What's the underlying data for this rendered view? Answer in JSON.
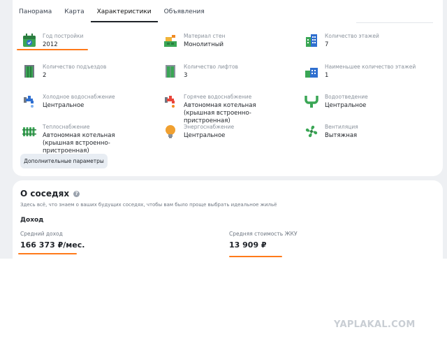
{
  "tabs": [
    {
      "label": "Панорама"
    },
    {
      "label": "Карта"
    },
    {
      "label": "Характеристики"
    },
    {
      "label": "Объявления"
    }
  ],
  "characteristics": [
    {
      "label": "Год постройки",
      "value": "2012",
      "icon": "calendar-icon"
    },
    {
      "label": "Материал стен",
      "value": "Монолитный",
      "icon": "bricks-icon"
    },
    {
      "label": "Количество этажей",
      "value": "7",
      "icon": "building-icon"
    },
    {
      "label": "Количество подъездов",
      "value": "2",
      "icon": "entrance-icon"
    },
    {
      "label": "Количество лифтов",
      "value": "3",
      "icon": "elevator-icon"
    },
    {
      "label": "Наименьшее количество этажей",
      "value": "1",
      "icon": "low-building-icon"
    },
    {
      "label": "Холодное водоснабжение",
      "value": "Центральное",
      "icon": "cold-tap-icon"
    },
    {
      "label": "Горячее водоснабжение",
      "value": "Автономная котельная (крышная встроенно-пристроенная)",
      "icon": "hot-tap-icon"
    },
    {
      "label": "Водоотведение",
      "value": "Центральное",
      "icon": "drain-pipe-icon"
    },
    {
      "label": "Теплоснабжение",
      "value": "Автономная котельная (крышная встроенно-пристроенная)",
      "icon": "radiator-icon"
    },
    {
      "label": "Энергоснабжение",
      "value": "Центральное",
      "icon": "lightbulb-icon"
    },
    {
      "label": "Вентиляция",
      "value": "Вытяжная",
      "icon": "fan-icon"
    }
  ],
  "more_button": "Дополнительные параметры",
  "neighbors": {
    "title": "О соседях",
    "help": "?",
    "subtitle": "Здесь всё, что знаем о ваших будущих соседях, чтобы вам было проще выбрать идеальное жильё",
    "section": "Доход",
    "income_label": "Средний доход",
    "income_value": "166 373 ₽/мес.",
    "utilities_label": "Средняя стоимость ЖКУ",
    "utilities_value": "13 909 ₽"
  },
  "watermark": "YAPLAKAL.COM",
  "colors": {
    "accent": "#ff7a1a",
    "icon_green": "#3aa655",
    "icon_blue": "#2f6fd0",
    "icon_orange": "#f08a24"
  }
}
